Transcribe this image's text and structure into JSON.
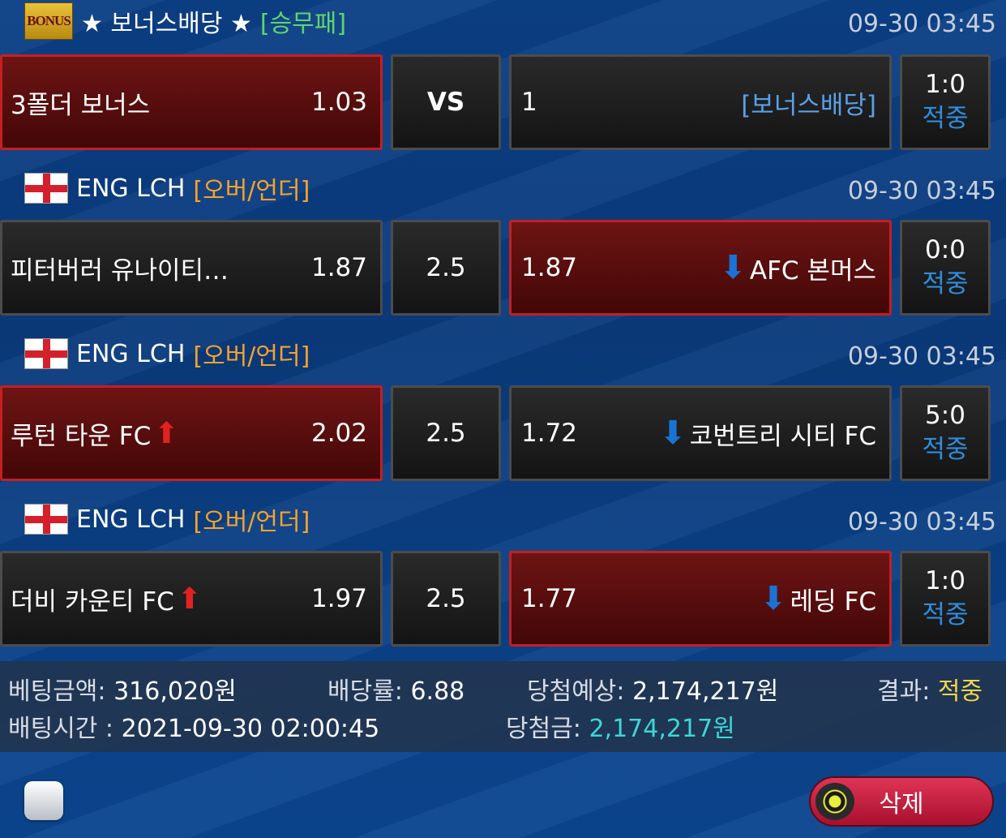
{
  "games": [
    {
      "badge": "BONUS",
      "league": "★ 보너스배당 ★",
      "bet_type": "[승무패]",
      "time": "09-30 03:45",
      "home": {
        "name": "3폴더 보너스",
        "odds": "1.03"
      },
      "middle": "VS",
      "away": {
        "name": "[보너스배당]",
        "odds": "1"
      },
      "score": "1:0",
      "status": "적중",
      "selected": "home"
    },
    {
      "league": "ENG LCH",
      "bet_type": "[오버/언더]",
      "time": "09-30 03:45",
      "home": {
        "name": "피터버러 유나이티…",
        "odds": "1.87"
      },
      "middle": "2.5",
      "away": {
        "name": "AFC 본머스",
        "odds": "1.87"
      },
      "score": "0:0",
      "status": "적중",
      "selected": "away"
    },
    {
      "league": "ENG LCH",
      "bet_type": "[오버/언더]",
      "time": "09-30 03:45",
      "home": {
        "name": "루턴 타운 FC",
        "odds": "2.02"
      },
      "middle": "2.5",
      "away": {
        "name": "코번트리 시티 FC",
        "odds": "1.72"
      },
      "score": "5:0",
      "status": "적중",
      "selected": "home"
    },
    {
      "league": "ENG LCH",
      "bet_type": "[오버/언더]",
      "time": "09-30 03:45",
      "home": {
        "name": "더비 카운티 FC",
        "odds": "1.97"
      },
      "middle": "2.5",
      "away": {
        "name": "레딩 FC",
        "odds": "1.77"
      },
      "score": "1:0",
      "status": "적중",
      "selected": "away"
    }
  ],
  "summary": {
    "bet_amount_label": "베팅금액:",
    "bet_amount": "316,020원",
    "odds_label": "배당률:",
    "odds": "6.88",
    "expected_label": "당첨예상:",
    "expected": "2,174,217원",
    "result_label": "결과:",
    "result": "적중",
    "bet_time_label": "배팅시간 :",
    "bet_time": "2021-09-30 02:00:45",
    "win_label": "당첨금:",
    "win": "2,174,217원"
  },
  "actions": {
    "delete_label": "삭제"
  },
  "icons": {
    "up": "red-up-arrow-icon",
    "down": "blue-down-arrow-icon",
    "flag": "england-flag-icon"
  },
  "colors": {
    "selected": "#6e1414",
    "win_status": "#2f8de0",
    "result": "#f0d64a",
    "win_amount": "#3dd6d6"
  }
}
